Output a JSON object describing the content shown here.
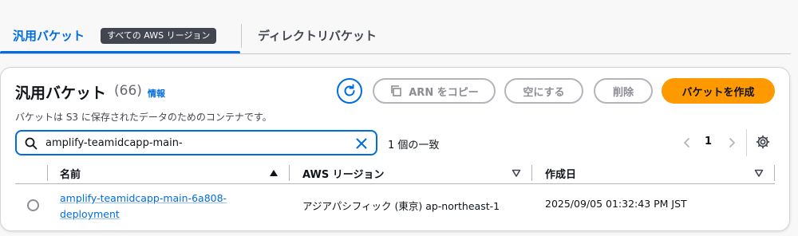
{
  "tabs": {
    "active_label": "汎用バケット",
    "active_badge": "すべての AWS リージョン",
    "other_label": "ディレクトリバケット"
  },
  "panel": {
    "title": "汎用バケット",
    "count": "(66)",
    "info": "情報",
    "description": "バケットは S3 に保存されたデータのためのコンテナです。"
  },
  "actions": {
    "copy_arn": "ARN をコピー",
    "empty": "空にする",
    "delete": "削除",
    "create": "バケットを作成"
  },
  "search": {
    "value": "amplify-teamidcapp-main-",
    "match_count": "1 個の一致"
  },
  "pagination": {
    "current_page": "1"
  },
  "table": {
    "columns": [
      "名前",
      "AWS リージョン",
      "作成日"
    ],
    "rows": [
      {
        "name": "amplify-teamidcapp-main-6a808-deployment",
        "region": "アジアパシフィック (東京) ap-northeast-1",
        "created": "2025/09/05 01:32:43 PM JST"
      }
    ]
  },
  "colors": {
    "accent": "#006ce0",
    "primary_button": "#ff9900",
    "badge": "#424650"
  }
}
